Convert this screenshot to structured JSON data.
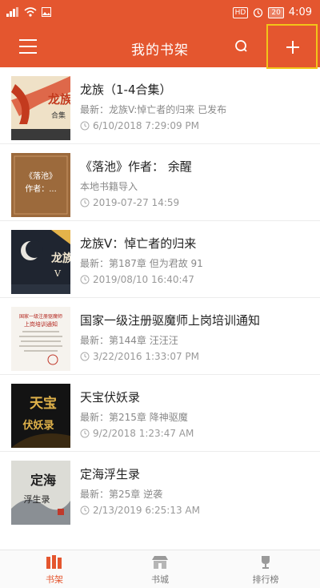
{
  "status": {
    "time": "4:09",
    "battery": "20",
    "hd": "HD"
  },
  "header": {
    "title": "我的书架"
  },
  "books": [
    {
      "title": "龙族（1-4合集）",
      "latest": "最新：龙族V:悼亡者的归来 已发布",
      "time": "6/10/2018 7:29:09 PM",
      "cover_text": "龙族",
      "cover_sub": "合集"
    },
    {
      "title": "《落池》作者： 余醒",
      "latest": "本地书籍导入",
      "time": "2019-07-27 14:59",
      "cover_text": "《落池》",
      "cover_sub": "作者：..."
    },
    {
      "title": "龙族V：悼亡者的归来",
      "latest": "最新：第187章 但为君故 91",
      "time": "2019/08/10 16:40:47",
      "cover_text": "龙族",
      "cover_sub": "V"
    },
    {
      "title": "国家一级注册驱魔师上岗培训通知",
      "latest": "最新：第144章 汪汪汪",
      "time": "3/22/2016 1:33:07 PM",
      "cover_text": "国家一级注册驱魔师",
      "cover_sub": "上岗培训通知"
    },
    {
      "title": "天宝伏妖录",
      "latest": "最新：第215章 降神驱魔",
      "time": "9/2/2018 1:23:47 AM",
      "cover_text": "天宝",
      "cover_sub": "伏妖录"
    },
    {
      "title": "定海浮生录",
      "latest": "最新：第25章 逆袭",
      "time": "2/13/2019 6:25:13 AM",
      "cover_text": "定海",
      "cover_sub": "浮生录"
    }
  ],
  "tabs": [
    {
      "label": "书架"
    },
    {
      "label": "书城"
    },
    {
      "label": "排行榜"
    }
  ],
  "colors": {
    "accent": "#e4562f",
    "highlight": "#f2c419"
  }
}
